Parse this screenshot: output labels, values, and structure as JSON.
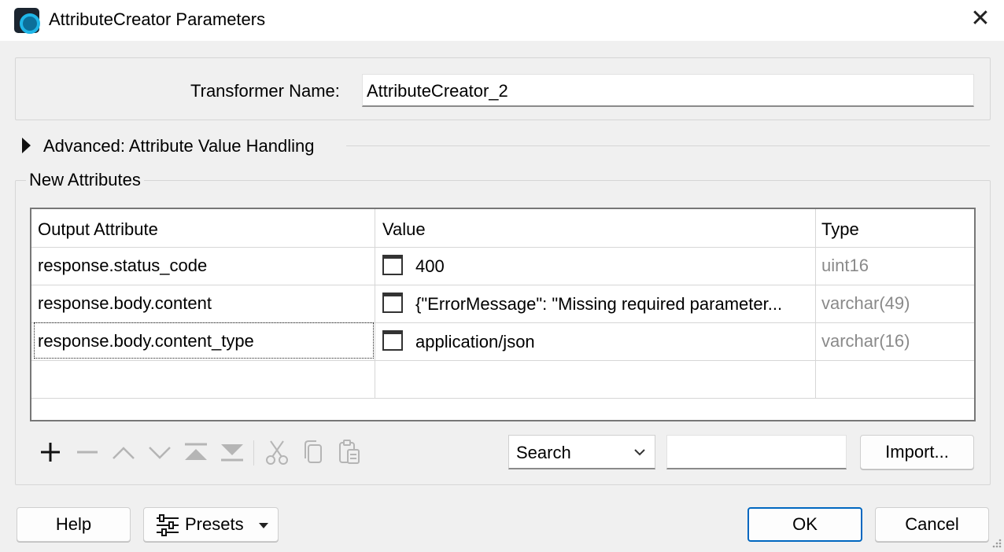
{
  "window": {
    "title": "AttributeCreator Parameters",
    "close_icon": "close-icon",
    "app_icon": "fme-app-icon"
  },
  "transformer_name": {
    "label": "Transformer Name:",
    "value": "AttributeCreator_2"
  },
  "advanced": {
    "label": "Advanced: Attribute Value Handling",
    "expanded": false
  },
  "new_attributes": {
    "title": "New Attributes",
    "columns": [
      "Output Attribute",
      "Value",
      "Type"
    ],
    "rows": [
      {
        "attribute": "response.status_code",
        "value": "400",
        "type": "uint16"
      },
      {
        "attribute": "response.body.content",
        "value": "{\"ErrorMessage\": \"Missing required parameter...",
        "type": "varchar(49)"
      },
      {
        "attribute": "response.body.content_type",
        "value": "application/json",
        "type": "varchar(16)"
      }
    ],
    "toolbar_icons": [
      "add-icon",
      "remove-icon",
      "move-up-icon",
      "move-down-icon",
      "move-to-top-icon",
      "move-to-bottom-icon",
      "cut-icon",
      "copy-icon",
      "paste-icon"
    ],
    "search_select": "Search",
    "search_value": "",
    "import_label": "Import..."
  },
  "footer": {
    "help_label": "Help",
    "presets_label": "Presets",
    "ok_label": "OK",
    "cancel_label": "Cancel"
  },
  "colors": {
    "accent": "#0067c0",
    "type_text": "#8a8a8a",
    "icon_disabled": "#b5b5b5"
  }
}
